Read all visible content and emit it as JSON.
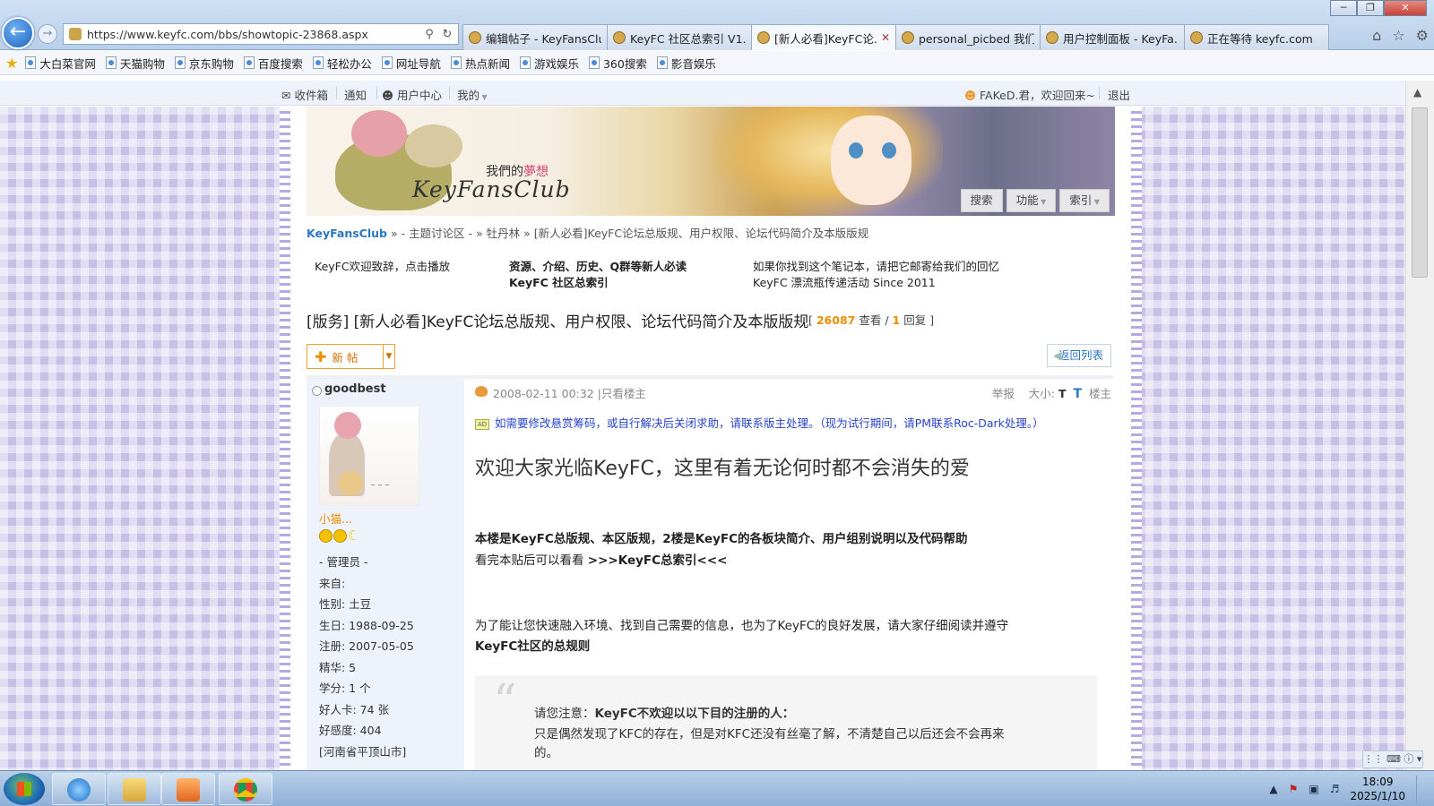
{
  "browser": {
    "address": "https://www.keyfc.com/bbs/showtopic-23868.aspx",
    "tabs": [
      {
        "label": "编辑帖子 - KeyFansClu...",
        "active": false
      },
      {
        "label": "KeyFC 社区总索引 V1....",
        "active": false
      },
      {
        "label": "[新人必看]KeyFC论...",
        "active": true
      },
      {
        "label": "personal_picbed 我们|...",
        "active": false
      },
      {
        "label": "用户控制面板 - KeyFa...",
        "active": false
      },
      {
        "label": "正在等待 keyfc.com",
        "active": false
      }
    ],
    "favorites": [
      "大白菜官网",
      "天猫购物",
      "京东购物",
      "百度搜索",
      "轻松办公",
      "网址导航",
      "热点新闻",
      "游戏娱乐",
      "360搜索",
      "影音娱乐"
    ]
  },
  "userbar": {
    "inbox": "收件箱",
    "notify": "通知",
    "usercenter": "用户中心",
    "mine": "我的",
    "welcome": "FAKeD.君，欢迎回来~",
    "logout": "退出"
  },
  "banner": {
    "brand": "KeyFansClub",
    "subtitle_a": "我們的",
    "subtitle_b": "夢想",
    "buttons": [
      "搜索",
      "功能",
      "索引"
    ]
  },
  "breadcrumb": {
    "home": "KeyFansClub",
    "trail": " » - 主题讨论区 - » 牡丹林 » [新人必看]KeyFC论坛总版规、用户权限、论坛代码简介及本版版规"
  },
  "notices": {
    "col1": "KeyFC欢迎致辞，点击播放",
    "col2a": "资源、介绍、历史、Q群等新人必读",
    "col2b": "KeyFC 社区总索引",
    "col3a": "如果你找到这个笔记本，请把它邮寄给我们的回忆",
    "col3b": "KeyFC 漂流瓶传递活动 Since 2011"
  },
  "thread": {
    "title": "[版务] [新人必看]KeyFC论坛总版规、用户权限、论坛代码简介及本版版规",
    "views": "26087",
    "replies": "1",
    "views_label": "查看",
    "replies_label": "回复",
    "new_post": "新 帖",
    "back": "返回列表"
  },
  "author": {
    "name": "goodbest",
    "nickname": "小猫...",
    "role": "- 管理员 -",
    "rows": [
      "来自:",
      "性别: 土豆",
      "生日: 1988-09-25",
      "注册:  2007-05-05",
      "精华: 5",
      "学分: 1 个",
      "好人卡: 74 张",
      "好感度: 404",
      "[河南省平顶山市]"
    ]
  },
  "post": {
    "date": "2008-02-11 00:32",
    "only_author": "|只看楼主",
    "report": "举报",
    "size": "大小:",
    "floor": "楼主",
    "ad": "如需要修改悬赏筹码，或自行解决后关闭求助，请联系版主处理。（现为试行期间，请PM联系Roc-Dark处理。）",
    "headline": "欢迎大家光临KeyFC，这里有着无论何时都不会消失的爱",
    "l1": "本楼是KeyFC总版规、本区版规，2楼是KeyFC的各板块简介、用户组别说明以及代码帮助",
    "l2a": "看完本贴后可以看看 ",
    "l2b": ">>>KeyFC总索引<<<",
    "l3": "为了能让您快速融入环境、找到自己需要的信息，也为了KeyFC的良好发展，请大家仔细阅读并遵守",
    "l4": "KeyFC社区的总规则",
    "q1a": "请您注意：",
    "q1b": "KeyFC不欢迎以以下目的注册的人：",
    "q2": "只是偶然发现了KFC的存在，但是对KFC还没有丝毫了解，不清楚自己以后还会不会再来",
    "q3": "的。"
  },
  "taskbar": {
    "time": "18:09",
    "date": "2025/1/10"
  }
}
